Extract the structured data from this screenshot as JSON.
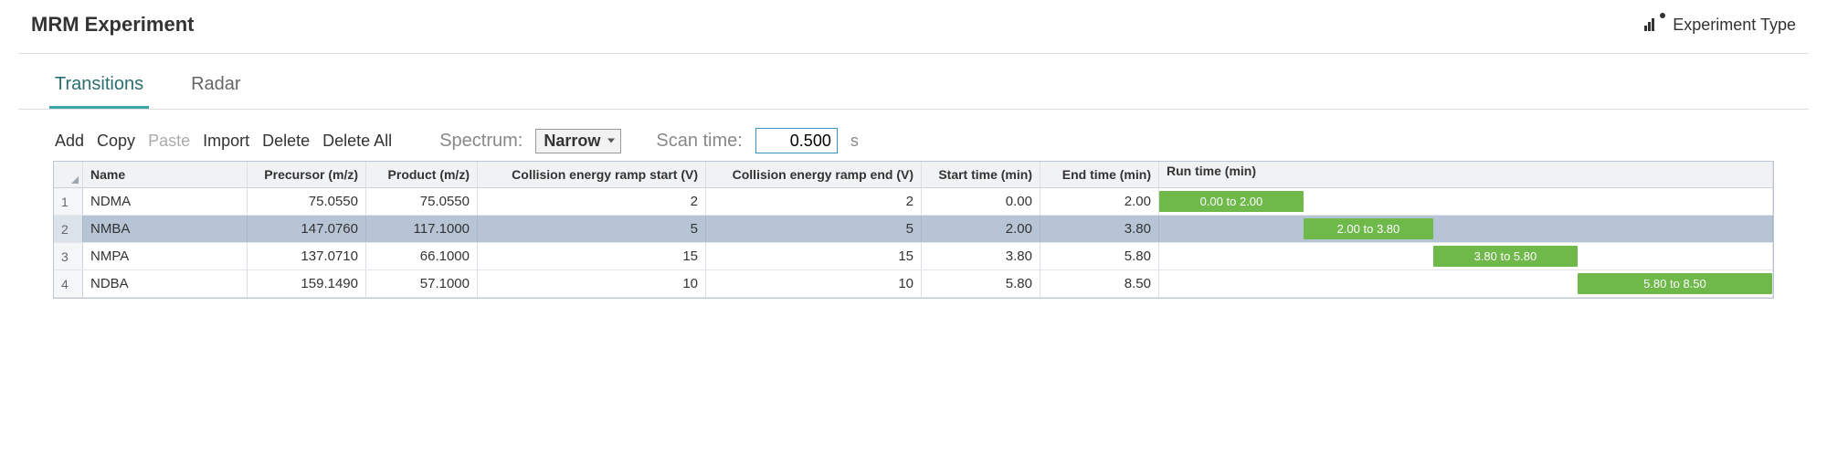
{
  "header": {
    "title": "MRM Experiment",
    "experiment_type_label": "Experiment Type"
  },
  "tabs": [
    {
      "label": "Transitions",
      "active": true
    },
    {
      "label": "Radar",
      "active": false
    }
  ],
  "toolbar": {
    "add": "Add",
    "copy": "Copy",
    "paste": "Paste",
    "import": "Import",
    "delete": "Delete",
    "delete_all": "Delete All",
    "spectrum_label": "Spectrum:",
    "spectrum_value": "Narrow",
    "scan_time_label": "Scan time:",
    "scan_time_value": "0.500",
    "scan_time_unit": "s"
  },
  "columns": {
    "name": "Name",
    "precursor": "Precursor (m/z)",
    "product": "Product (m/z)",
    "ce_start": "Collision energy ramp start (V)",
    "ce_end": "Collision energy ramp end (V)",
    "start_time": "Start time (min)",
    "end_time": "End time (min)",
    "run_time": "Run time (min)"
  },
  "runtime_axis": {
    "min": 0.0,
    "max": 8.5
  },
  "rows": [
    {
      "idx": "1",
      "name": "NDMA",
      "precursor": "75.0550",
      "product": "75.0550",
      "ce_start": "2",
      "ce_end": "2",
      "start_time": "0.00",
      "end_time": "2.00",
      "gantt_label": "0.00 to 2.00",
      "selected": false
    },
    {
      "idx": "2",
      "name": "NMBA",
      "precursor": "147.0760",
      "product": "117.1000",
      "ce_start": "5",
      "ce_end": "5",
      "start_time": "2.00",
      "end_time": "3.80",
      "gantt_label": "2.00 to 3.80",
      "selected": true
    },
    {
      "idx": "3",
      "name": "NMPA",
      "precursor": "137.0710",
      "product": "66.1000",
      "ce_start": "15",
      "ce_end": "15",
      "start_time": "3.80",
      "end_time": "5.80",
      "gantt_label": "3.80 to 5.80",
      "selected": false
    },
    {
      "idx": "4",
      "name": "NDBA",
      "precursor": "159.1490",
      "product": "57.1000",
      "ce_start": "10",
      "ce_end": "10",
      "start_time": "5.80",
      "end_time": "8.50",
      "gantt_label": "5.80 to 8.50",
      "selected": false
    }
  ]
}
